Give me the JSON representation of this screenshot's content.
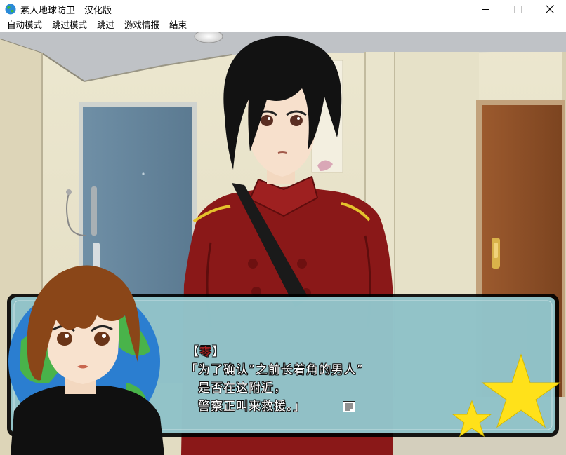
{
  "window": {
    "title": "素人地球防卫　汉化版",
    "minimize_icon": "minimize-icon",
    "maximize_icon": "maximize-icon",
    "close_icon": "close-icon"
  },
  "menu": [
    {
      "label": "自动模式"
    },
    {
      "label": "跳过模式"
    },
    {
      "label": "跳过"
    },
    {
      "label": "游戏情报"
    },
    {
      "label": "结束"
    }
  ],
  "dialog": {
    "bracket_open": "【",
    "speaker": "零",
    "bracket_close": "】",
    "lines": [
      "「为了确认”之前长着角的男人”",
      "　是否在这附近，",
      "　警察正叫来救援。」"
    ],
    "advance_icon": "page-advance-icon"
  },
  "colors": {
    "textbox": "#9fd6e0",
    "speaker_name": "#b02020",
    "uniform": "#8a1818"
  }
}
